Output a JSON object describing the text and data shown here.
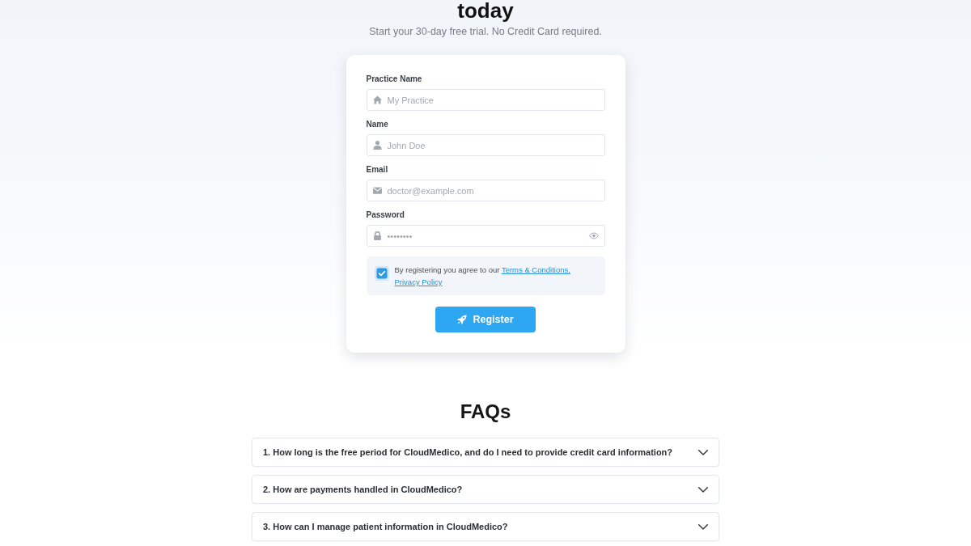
{
  "header": {
    "title": "today",
    "subtitle": "Start your 30-day free trial. No Credit Card required."
  },
  "form": {
    "fields": [
      {
        "label": "Practice Name",
        "kind": "text",
        "placeholder": "My Practice"
      },
      {
        "label": "Name",
        "kind": "text",
        "placeholder": "John Doe"
      },
      {
        "label": "Email",
        "kind": "email",
        "placeholder": "doctor@example.com"
      },
      {
        "label": "Password",
        "kind": "password",
        "placeholder": "••••••••"
      }
    ],
    "agreement": {
      "checked": true,
      "text": "By registering you agree to our",
      "links": [
        "Terms & Conditions,",
        "Privacy Policy"
      ]
    },
    "submit": "Register"
  },
  "faq": {
    "title": "FAQs",
    "items": [
      {
        "question": "1. How long is the free period for CloudMedico, and do I need to provide credit card information?",
        "expanded": false
      },
      {
        "question": "2. How are payments handled in CloudMedico?",
        "expanded": false
      },
      {
        "question": "3. How can I manage patient information in CloudMedico?",
        "expanded": false
      }
    ]
  }
}
